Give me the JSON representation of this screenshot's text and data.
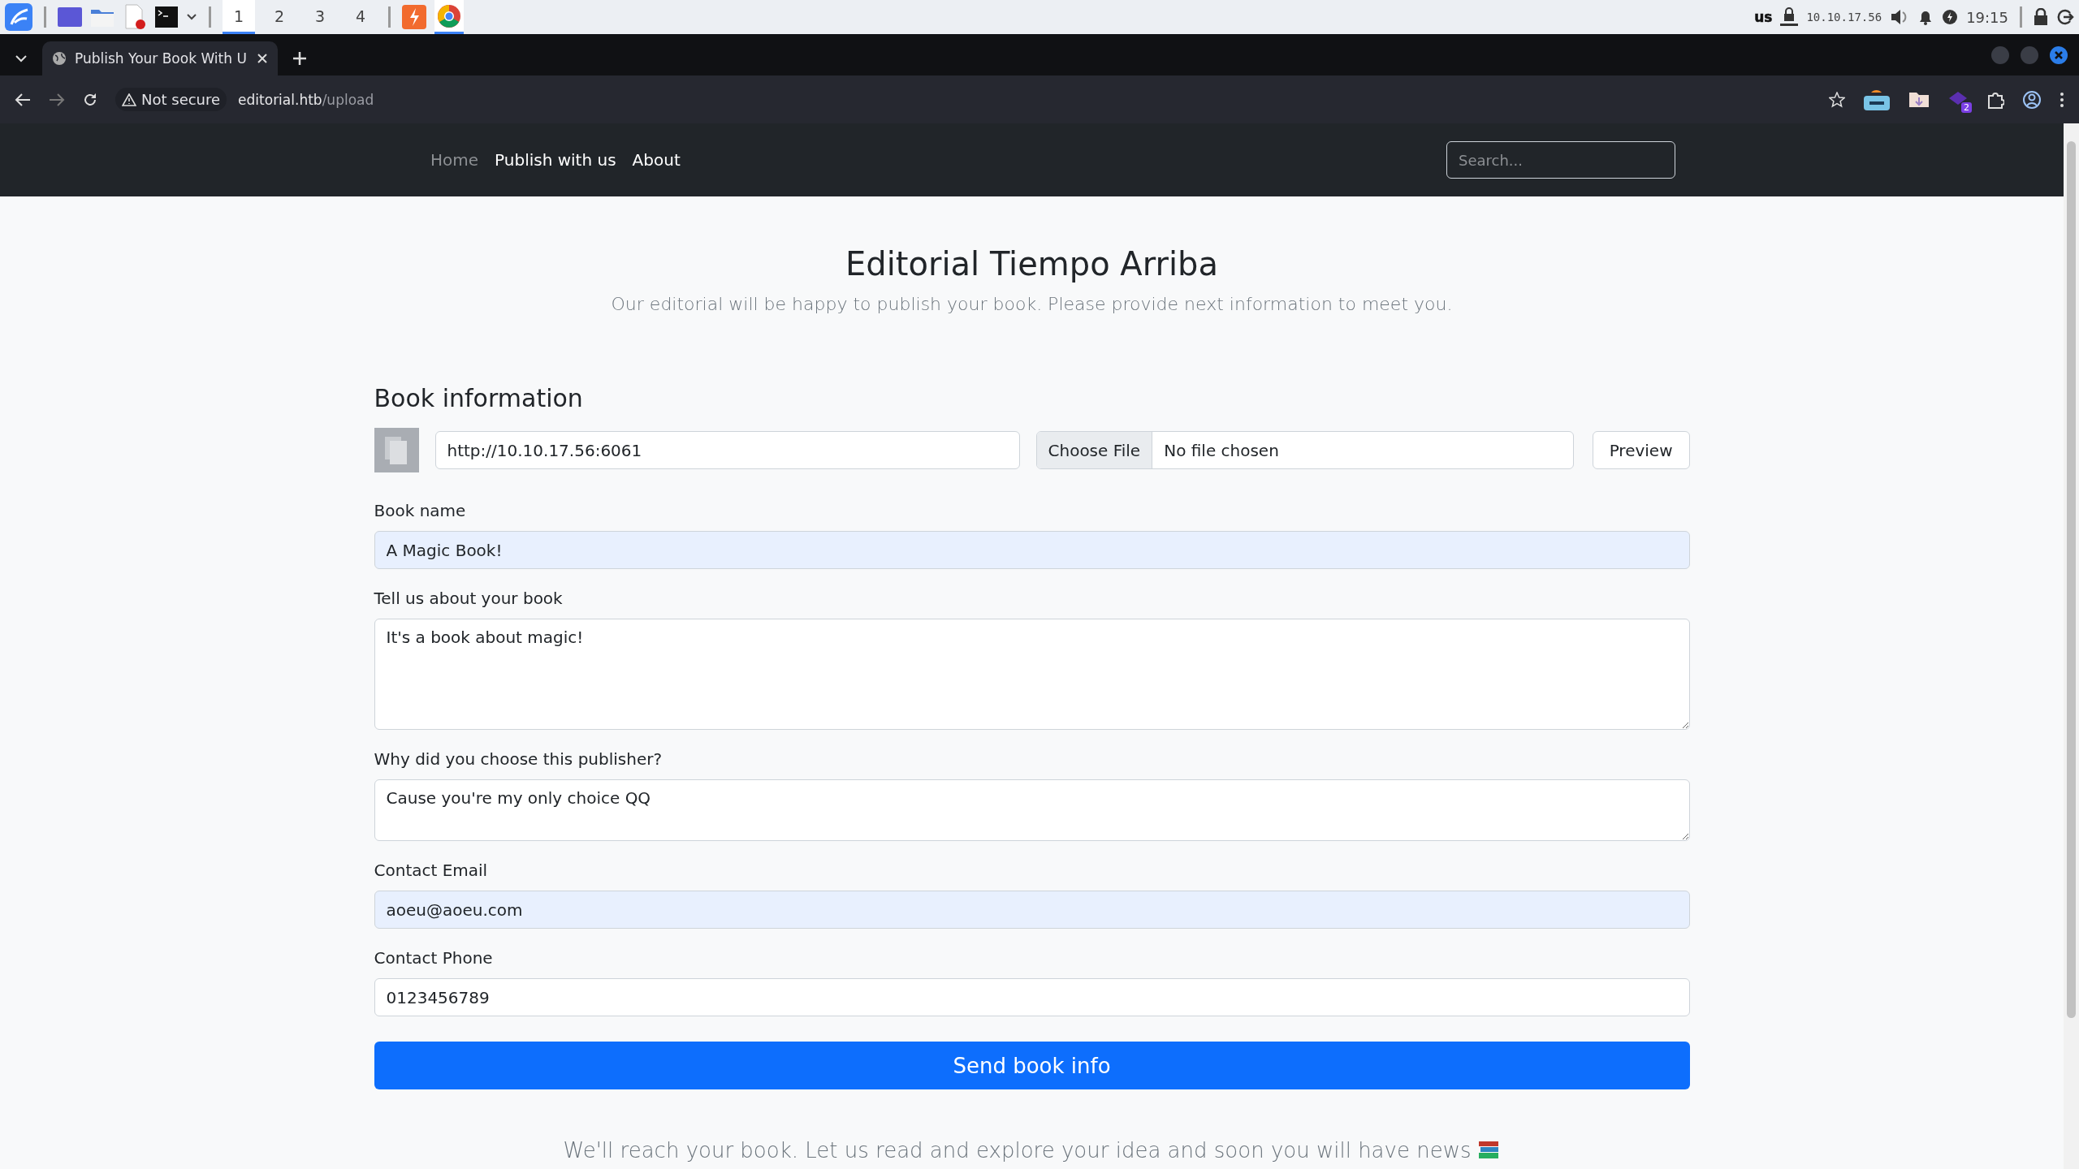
{
  "taskbar": {
    "workspaces": [
      {
        "label": "1",
        "selected": true
      },
      {
        "label": "2",
        "selected": false
      },
      {
        "label": "3",
        "selected": false
      },
      {
        "label": "4",
        "selected": false
      }
    ],
    "keyboard_layout": "us",
    "ip_address": "10.10.17.56",
    "clock": "19:15"
  },
  "browser": {
    "tab": {
      "title": "Publish Your Book With U",
      "selected": true
    },
    "address": {
      "security": "Not secure",
      "domain": "editorial.htb",
      "path": "/upload"
    },
    "extension_badge": "2"
  },
  "navbar": {
    "items": [
      {
        "label": "Home",
        "disabled": true
      },
      {
        "label": "Publish with us",
        "disabled": false
      },
      {
        "label": "About",
        "disabled": false
      }
    ],
    "search": {
      "placeholder": "Search..."
    }
  },
  "page": {
    "title": "Editorial Tiempo Arriba",
    "subtitle": "Our editorial will be happy to publish your book. Please provide next information to meet you.",
    "section_title": "Book information",
    "cover_url": {
      "value": "http://10.10.17.56:6061"
    },
    "file_input": {
      "button": "Choose File",
      "status": "No file chosen"
    },
    "preview_button": "Preview",
    "fields": [
      {
        "label": "Book name",
        "kind": "input",
        "value": "A Magic Book!",
        "autofilled": true
      },
      {
        "label": "Tell us about your book",
        "kind": "textarea",
        "value": "It's a book about magic!",
        "autofilled": false
      },
      {
        "label": "Why did you choose this publisher?",
        "kind": "memo",
        "value": "Cause you're my only choice QQ",
        "autofilled": false
      },
      {
        "label": "Contact Email",
        "kind": "input",
        "value": "aoeu@aoeu.com",
        "autofilled": true
      },
      {
        "label": "Contact Phone",
        "kind": "input",
        "value": "0123456789",
        "autofilled": false
      }
    ],
    "submit_button": "Send book info",
    "footer": "We'll reach your book. Let us read and explore your idea and soon you will have news"
  }
}
